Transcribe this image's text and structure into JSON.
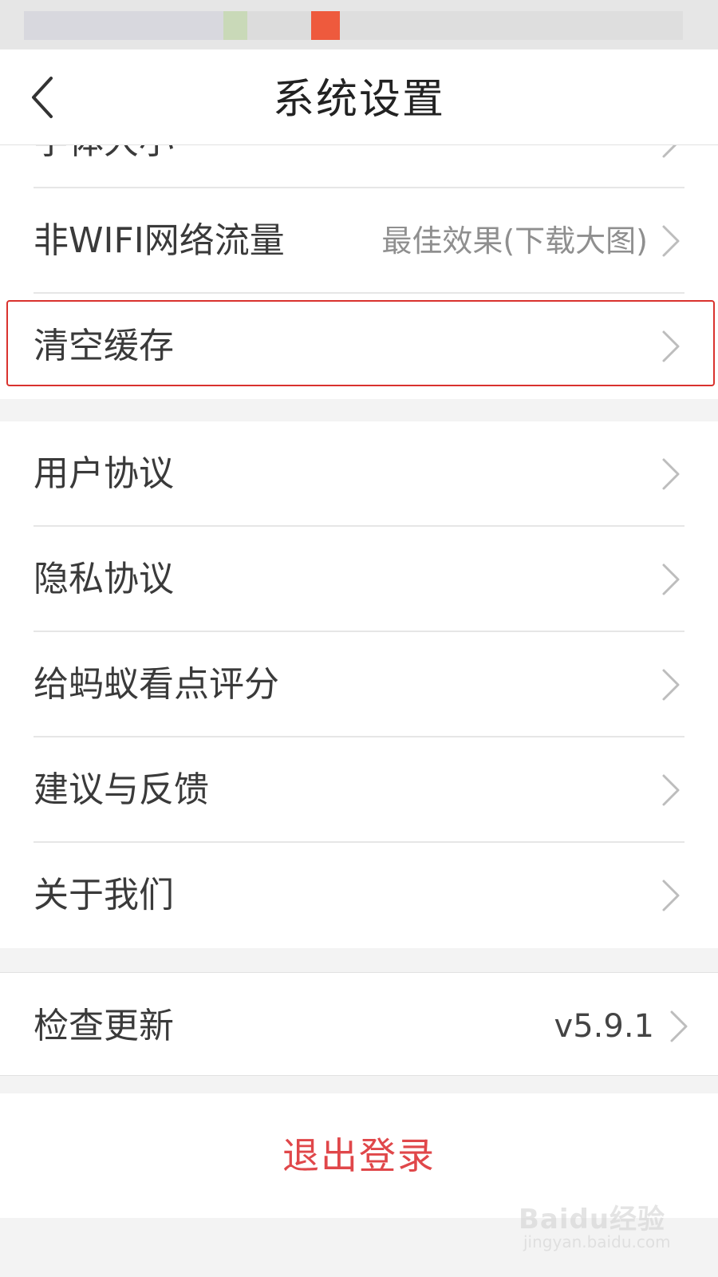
{
  "header": {
    "title": "系统设置"
  },
  "partial_row": {
    "label": "字体大小"
  },
  "rows_group1": [
    {
      "label": "非WIFI网络流量",
      "value": "最佳效果(下载大图)"
    },
    {
      "label": "清空缓存",
      "value": ""
    }
  ],
  "rows_group2": [
    {
      "label": "用户协议"
    },
    {
      "label": "隐私协议"
    },
    {
      "label": "给蚂蚁看点评分"
    },
    {
      "label": "建议与反馈"
    },
    {
      "label": "关于我们"
    }
  ],
  "update_row": {
    "label": "检查更新",
    "value": "v5.9.1"
  },
  "logout": {
    "label": "退出登录"
  },
  "watermark": {
    "main": "Baidu经验",
    "sub": "jingyan.baidu.com"
  },
  "colors": {
    "accent": "#e0474a",
    "highlight_border": "#d9322e",
    "background": "#f3f3f3"
  }
}
